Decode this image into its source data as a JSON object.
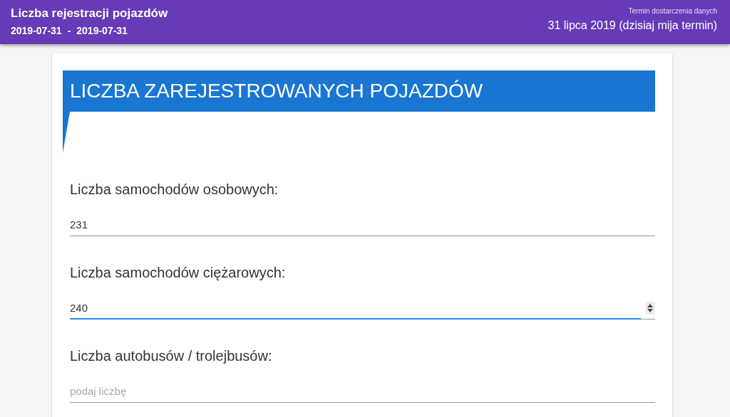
{
  "header": {
    "title": "Liczba rejestracji pojazdów",
    "date_from": "2019-07-31",
    "separator": "-",
    "date_to": "2019-07-31",
    "deadline_label": "Termin dostarczenia danych",
    "deadline": "31 lipca 2019 (dzisiaj mija termin)"
  },
  "section": {
    "title": "LICZBA ZAREJESTROWANYCH POJAZDÓW"
  },
  "fields": [
    {
      "label": "Liczba samochodów osobowych:",
      "value": "231",
      "focused": false
    },
    {
      "label": "Liczba samochodów ciężarowych:",
      "value": "240",
      "focused": true
    },
    {
      "label": "Liczba autobusów / trolejbusów:",
      "placeholder": "podaj liczbę",
      "focused": false
    }
  ]
}
